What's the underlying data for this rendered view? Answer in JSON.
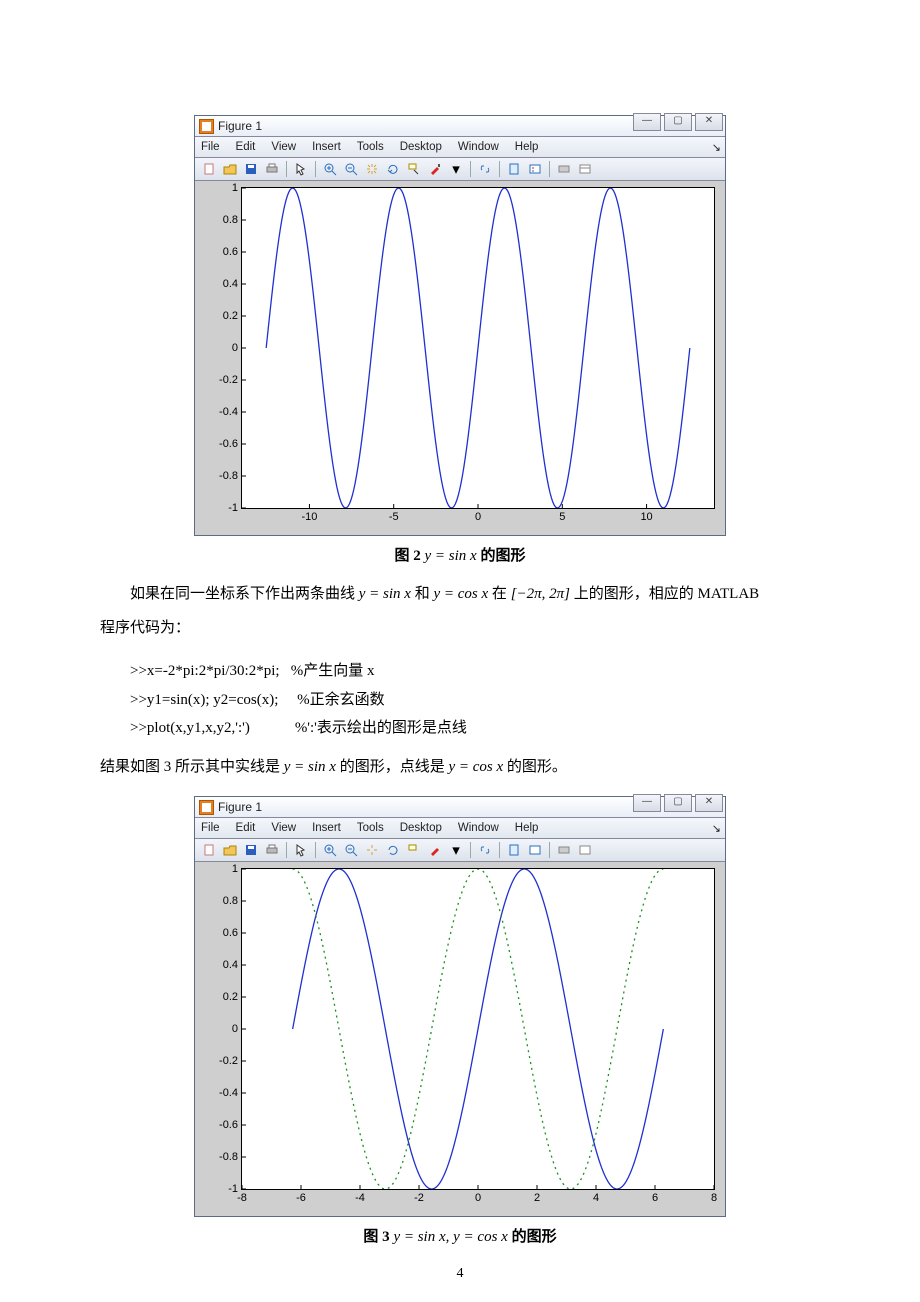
{
  "figure1": {
    "window_title": "Figure 1",
    "menus": [
      "File",
      "Edit",
      "View",
      "Insert",
      "Tools",
      "Desktop",
      "Window",
      "Help"
    ],
    "winbtns": [
      "—",
      "▢",
      "✕"
    ]
  },
  "chart_data": [
    {
      "type": "line",
      "title": "",
      "xlabel": "",
      "ylabel": "",
      "xlim": [
        -14,
        14
      ],
      "ylim": [
        -1,
        1
      ],
      "xticks": [
        -10,
        -5,
        0,
        5,
        10
      ],
      "yticks": [
        -1,
        -0.8,
        -0.6,
        -0.4,
        -0.2,
        0,
        0.2,
        0.4,
        0.6,
        0.8,
        1
      ],
      "series": [
        {
          "name": "sin(x)",
          "style": "solid",
          "color": "#2030d0",
          "fn": "sin",
          "domain": [
            -12.566,
            12.566
          ]
        }
      ]
    },
    {
      "type": "line",
      "title": "",
      "xlabel": "",
      "ylabel": "",
      "xlim": [
        -8,
        8
      ],
      "ylim": [
        -1,
        1
      ],
      "xticks": [
        -8,
        -6,
        -4,
        -2,
        0,
        2,
        4,
        6,
        8
      ],
      "yticks": [
        -1,
        -0.8,
        -0.6,
        -0.4,
        -0.2,
        0,
        0.2,
        0.4,
        0.6,
        0.8,
        1
      ],
      "series": [
        {
          "name": "sin(x)",
          "style": "solid",
          "color": "#2030d0",
          "fn": "sin",
          "domain": [
            -6.283,
            6.283
          ]
        },
        {
          "name": "cos(x)",
          "style": "dotted",
          "color": "#1a9020",
          "fn": "cos",
          "domain": [
            -6.283,
            6.283
          ]
        }
      ]
    }
  ],
  "caption1_prefix": "图 2   ",
  "caption1_math": "y = sin x",
  "caption1_suffix": " 的图形",
  "para1_a": "如果在同一坐标系下作出两条曲线 ",
  "para1_m1": "y = sin x",
  "para1_b": " 和 ",
  "para1_m2": "y = cos x",
  "para1_c": " 在 ",
  "para1_m3": "[−2π, 2π]",
  "para1_d": " 上的图形，相应的 MATLAB",
  "para2": "程序代码为：",
  "code": ">>x=-2*pi:2*pi/30:2*pi;   %产生向量 x\n>>y1=sin(x); y2=cos(x);     %正余玄函数\n>>plot(x,y1,x,y2,':')            %':'表示绘出的图形是点线",
  "para3_a": "结果如图 3 所示其中实线是 ",
  "para3_m1": "y = sin x",
  "para3_b": " 的图形，点线是 ",
  "para3_m2": "y = cos x",
  "para3_c": " 的图形。",
  "caption2_prefix": "图 3   ",
  "caption2_math": "y = sin x,  y = cos x",
  "caption2_suffix": " 的图形",
  "pagenum": "4"
}
